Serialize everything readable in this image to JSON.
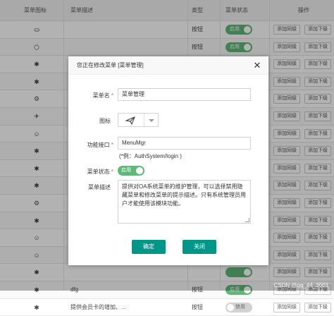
{
  "table": {
    "headers": [
      "菜单图标",
      "菜单描述",
      "类型",
      "菜单状态",
      "操作"
    ],
    "rows": [
      {
        "icon": "⛀",
        "desc": "",
        "type": "按钮",
        "status": "启用",
        "on": true
      },
      {
        "icon": "⬡",
        "desc": "",
        "type": "按钮",
        "status": "启用",
        "on": true
      },
      {
        "icon": "✱",
        "desc": "",
        "type": "",
        "status": "",
        "on": true
      },
      {
        "icon": "✱",
        "desc": "",
        "type": "",
        "status": "",
        "on": true
      },
      {
        "icon": "⚙",
        "desc": "",
        "type": "",
        "status": "",
        "on": true
      },
      {
        "icon": "✈",
        "desc": "",
        "type": "",
        "status": "",
        "on": true
      },
      {
        "icon": "☺",
        "desc": "",
        "type": "",
        "status": "",
        "on": true
      },
      {
        "icon": "✱",
        "desc": "",
        "type": "",
        "status": "",
        "on": true
      },
      {
        "icon": "✱",
        "desc": "",
        "type": "",
        "status": "",
        "on": true
      },
      {
        "icon": "✱",
        "desc": "",
        "type": "",
        "status": "",
        "on": true
      },
      {
        "icon": "⚙",
        "desc": "",
        "type": "",
        "status": "",
        "on": true
      },
      {
        "icon": "✱",
        "desc": "",
        "type": "",
        "status": "",
        "on": true
      },
      {
        "icon": "☺",
        "desc": "",
        "type": "",
        "status": "",
        "on": true
      },
      {
        "icon": "☺",
        "desc": "",
        "type": "",
        "status": "",
        "on": true
      },
      {
        "icon": "✱",
        "desc": "",
        "type": "",
        "status": "",
        "on": true
      },
      {
        "icon": "✱",
        "desc": "dfg",
        "type": "按钮",
        "status": "启用",
        "on": true
      },
      {
        "icon": "✱",
        "desc": "提供会员卡的增加、...",
        "type": "按钮",
        "status": "禁用",
        "on": false
      }
    ],
    "add_same_label": "添加同级",
    "add_child_label": "添加下级"
  },
  "dialog": {
    "title": "您正在修改菜单 [菜单管理]",
    "name_label": "菜单名",
    "name_value": "菜单管理",
    "icon_label": "图标",
    "api_label": "功能接口",
    "api_value": "MenuMgr",
    "api_hint": "(*例：AuthSystem/login )",
    "status_label": "菜单状态",
    "status_value": "启用",
    "desc_label": "菜单描述",
    "desc_value": "提供对OA系统菜单的维护管理，可以选择禁用隐藏菜单和修改菜单的提示描述。只有系统管理员用户才能使用该模块功能。",
    "confirm_label": "确定",
    "close_label": "关闭",
    "required_mark": "*"
  },
  "watermark": "CSDN @qq_44_3003",
  "colors": {
    "accent": "#009688",
    "toggle_on": "#5fb878",
    "required": "#ff5722"
  }
}
